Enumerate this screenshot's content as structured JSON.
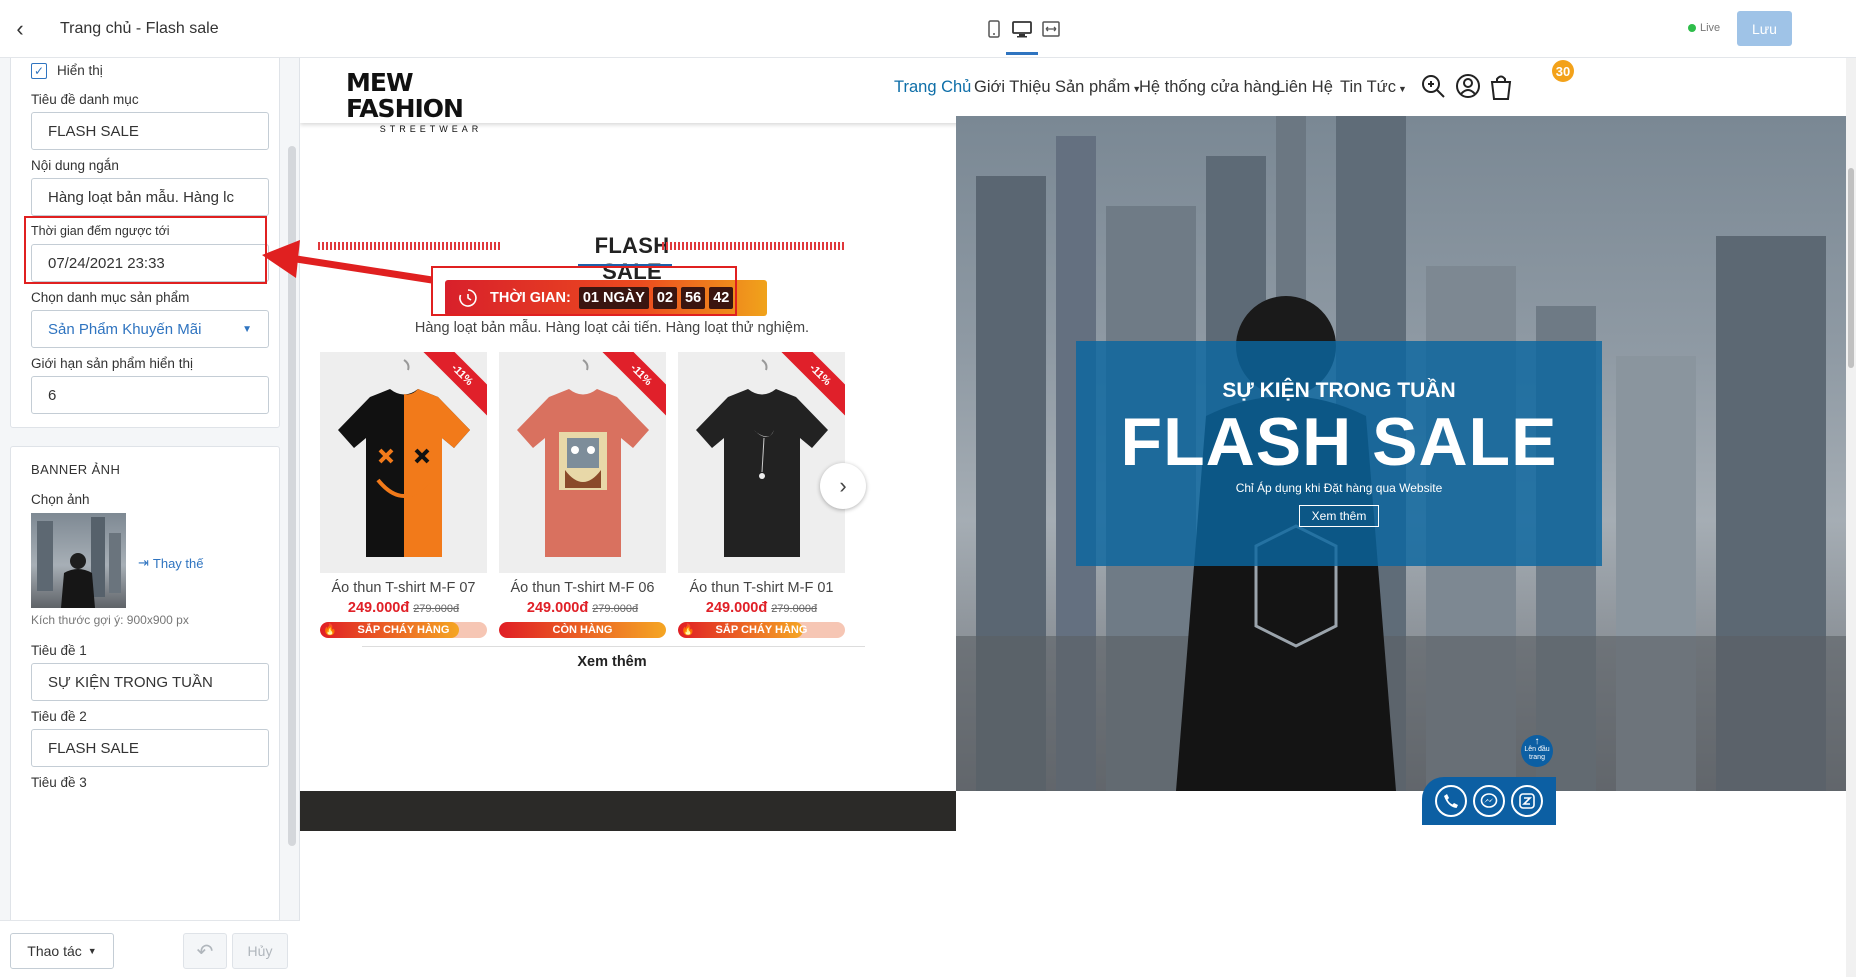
{
  "panel": {
    "title": "Trang chủ - Flash sale",
    "show_label": "Hiển thị",
    "category_title_label": "Tiêu đề danh mục",
    "category_title_value": "FLASH SALE",
    "short_content_label": "Nội dung ngắn",
    "short_content_value": "Hàng loạt bản mẫu. Hàng lc",
    "countdown_label": "Thời gian đếm ngược tới",
    "countdown_value": "07/24/2021 23:33",
    "product_category_label": "Chọn danh mục sản phẩm",
    "product_category_value": "Sản Phẩm Khuyến Mãi",
    "limit_label": "Giới hạn sản phẩm hiển thị",
    "limit_value": "6",
    "banner_section": "BANNER ẢNH",
    "choose_image_label": "Chọn ảnh",
    "replace_label": "Thay thế",
    "size_hint": "Kích thước gợi ý: 900x900 px",
    "title1_label": "Tiêu đề 1",
    "title1_value": "SỰ KIỆN TRONG TUẦN",
    "title2_label": "Tiêu đề 2",
    "title2_value": "FLASH SALE",
    "title3_label": "Tiêu đề 3",
    "actions_label": "Thao tác",
    "cancel_label": "Hủy"
  },
  "toolbar": {
    "live_label": "Live",
    "save_label": "Lưu"
  },
  "site": {
    "logo_main": "MEW FASHION",
    "logo_sub": "STREETWEAR",
    "nav": [
      "Trang Chủ",
      "Giới Thiệu",
      "Sản phẩm",
      "Hệ thống cửa hàng",
      "Liên Hệ",
      "Tin Tức"
    ],
    "cart_count": "30"
  },
  "flash_sale": {
    "title": "FLASH SALE",
    "timer_label": "THỜI GIAN:",
    "days": "01 NGÀY",
    "hours": "02",
    "minutes": "56",
    "seconds": "42",
    "description": "Hàng loạt bản mẫu. Hàng loạt cải tiến. Hàng loạt thử nghiệm.",
    "products": [
      {
        "name": "Áo thun T-shirt M-F 07",
        "price": "249.000đ",
        "old_price": "279.000đ",
        "discount": "-11%",
        "status": "SẮP CHÁY HÀNG",
        "sold_fraction": 0.83
      },
      {
        "name": "Áo thun T-shirt M-F 06",
        "price": "249.000đ",
        "old_price": "279.000đ",
        "discount": "-11%",
        "status": "CÒN HÀNG",
        "sold_fraction": 1.0
      },
      {
        "name": "Áo thun T-shirt M-F 01",
        "price": "249.000đ",
        "old_price": "279.000đ",
        "discount": "-11%",
        "status": "SẮP CHÁY HÀNG",
        "sold_fraction": 0.75
      }
    ],
    "more_label": "Xem thêm"
  },
  "banner": {
    "line1": "SỰ KIỆN TRONG TUẦN",
    "line2": "FLASH SALE",
    "line3": "Chỉ Áp dụng khi Đặt hàng qua Website",
    "button": "Xem thêm",
    "to_top": "Lên đầu trang"
  },
  "colors": {
    "accent": "#2f74c0",
    "sale_red": "#e02027",
    "overlay_blue": "#0b66a0"
  }
}
